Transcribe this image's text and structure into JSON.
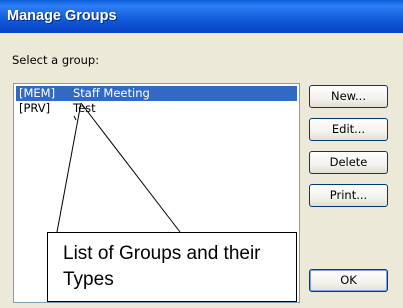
{
  "window": {
    "title": "Manage Groups"
  },
  "list_label": "Select a group:",
  "groups": [
    {
      "type": "[MEM]",
      "name": "Staff Meeting",
      "selected": true
    },
    {
      "type": "[PRV]",
      "name": "Test",
      "selected": false
    }
  ],
  "buttons": {
    "new": "New...",
    "edit": "Edit...",
    "delete": "Delete",
    "print": "Print...",
    "ok": "OK"
  },
  "callout": {
    "text": "List of Groups and their Types"
  },
  "colors": {
    "selection": "#316ac5",
    "dialog_bg": "#ece9d8"
  }
}
